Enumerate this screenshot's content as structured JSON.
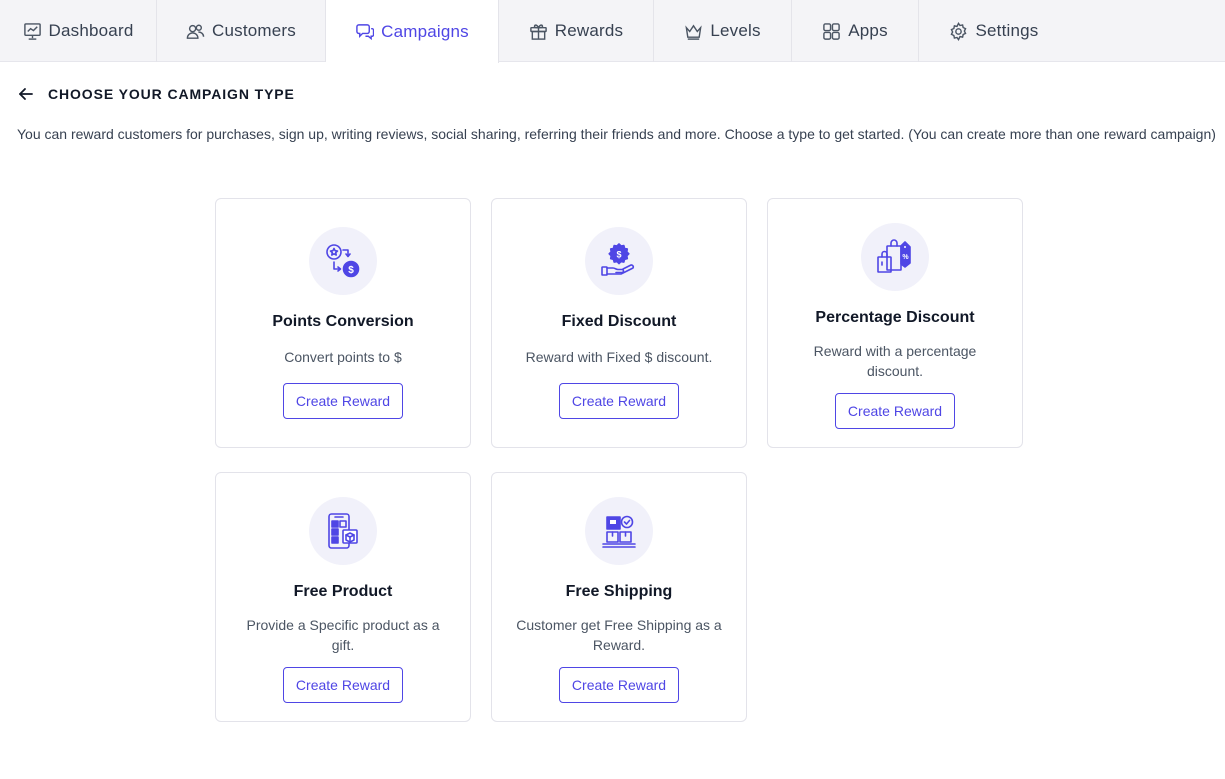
{
  "nav": {
    "tabs": [
      {
        "label": "Dashboard",
        "icon": "dashboard-icon"
      },
      {
        "label": "Customers",
        "icon": "customers-icon"
      },
      {
        "label": "Campaigns",
        "icon": "campaigns-icon",
        "active": true
      },
      {
        "label": "Rewards",
        "icon": "gift-icon"
      },
      {
        "label": "Levels",
        "icon": "crown-icon"
      },
      {
        "label": "Apps",
        "icon": "apps-grid-icon"
      },
      {
        "label": "Settings",
        "icon": "gear-icon"
      }
    ]
  },
  "header": {
    "title": "CHOOSE YOUR CAMPAIGN TYPE",
    "description": "You can reward customers for purchases, sign up, writing reviews, social sharing, referring their friends and more. Choose a type to get started. (You can create more than one reward campaign)"
  },
  "cards": [
    {
      "title": "Points Conversion",
      "desc": "Convert points to $",
      "button": "Create Reward",
      "icon": "points-conversion-icon"
    },
    {
      "title": "Fixed Discount",
      "desc": "Reward with Fixed $ discount.",
      "button": "Create Reward",
      "icon": "fixed-discount-icon"
    },
    {
      "title": "Percentage Discount",
      "desc": "Reward with a percentage discount.",
      "button": "Create Reward",
      "icon": "percentage-discount-icon"
    },
    {
      "title": "Free Product",
      "desc": "Provide a Specific product as a gift.",
      "button": "Create Reward",
      "icon": "free-product-icon"
    },
    {
      "title": "Free Shipping",
      "desc": "Customer get Free Shipping as a Reward.",
      "button": "Create Reward",
      "icon": "free-shipping-icon"
    }
  ],
  "colors": {
    "accent": "#4f46e5",
    "nav_bg": "#f4f4f7",
    "icon_bg": "#f1f1fa"
  }
}
